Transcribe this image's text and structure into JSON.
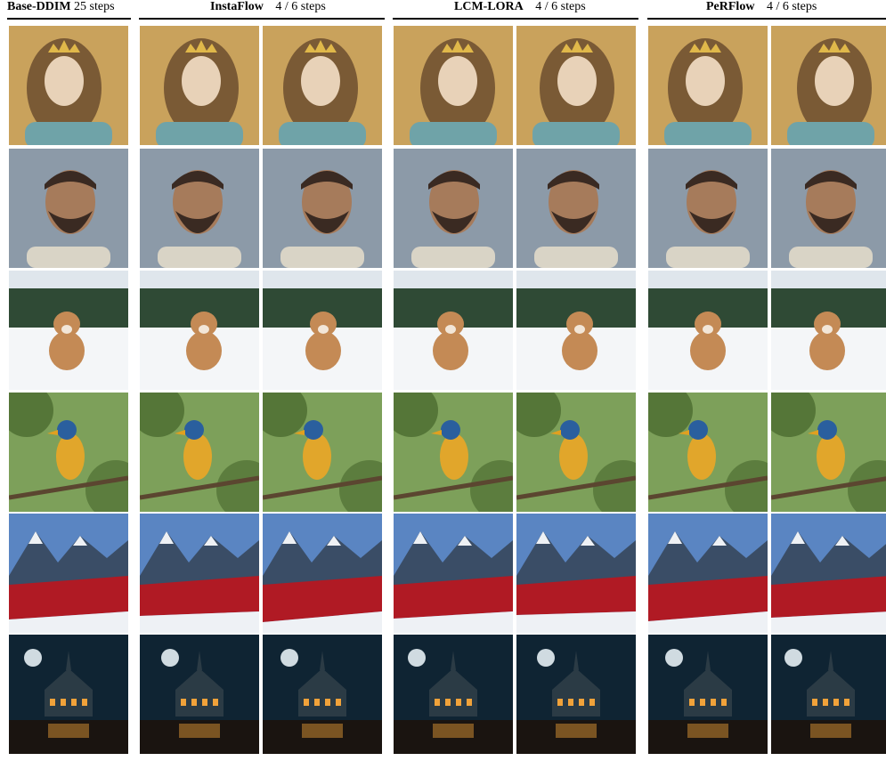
{
  "figure": {
    "columns": [
      {
        "method": "Base-DDIM",
        "steps": "25 steps"
      },
      {
        "method": "InstaFlow",
        "steps": "4 / 6 steps"
      },
      {
        "method": "LCM-LORA",
        "steps": "4 / 6 steps"
      },
      {
        "method": "PeRFlow",
        "steps": "4 / 6 steps"
      }
    ],
    "rows": [
      {
        "subject": "crowned-princess-portrait",
        "tones": [
          "#c9a25c",
          "#7a5a35",
          "#e8d2b8",
          "#6fa3a8"
        ]
      },
      {
        "subject": "bearded-man-portrait",
        "tones": [
          "#8c9aa8",
          "#3a2a22",
          "#a67b5b",
          "#d9d4c6"
        ]
      },
      {
        "subject": "puppy-in-snow",
        "tones": [
          "#dfe6ec",
          "#2f4a35",
          "#c48a55",
          "#f4f6f8"
        ]
      },
      {
        "subject": "colorful-bird-on-branch",
        "tones": [
          "#7da05a",
          "#3b5a22",
          "#e1a62b",
          "#2a5f9e"
        ]
      },
      {
        "subject": "red-mountain-valley",
        "tones": [
          "#5a85c2",
          "#eef1f5",
          "#b01a24",
          "#3a4d66"
        ]
      },
      {
        "subject": "castle-by-night-lake",
        "tones": [
          "#0f2433",
          "#2b3b45",
          "#f0a23a",
          "#1a1410"
        ]
      }
    ]
  }
}
